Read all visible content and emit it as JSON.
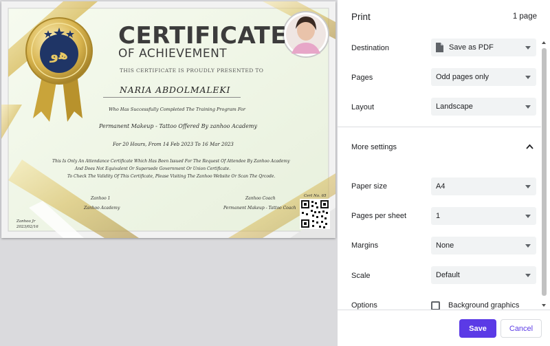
{
  "colors": {
    "accent": "#5b3ae6",
    "gold": "#d6b64e",
    "gold_dark": "#a8862a",
    "panel_bg": "#ffffff",
    "select_bg": "#f1f3f4",
    "preview_bg": "#dadadd"
  },
  "panel": {
    "title": "Print",
    "page_count": "1 page",
    "settings": [
      {
        "label": "Destination",
        "value": "Save as PDF",
        "icon": "document-icon"
      },
      {
        "label": "Pages",
        "value": "Odd pages only"
      },
      {
        "label": "Layout",
        "value": "Landscape"
      }
    ],
    "more_settings": {
      "label": "More settings",
      "icon": "chevron-up-icon"
    },
    "advanced": [
      {
        "label": "Paper size",
        "value": "A4"
      },
      {
        "label": "Pages per sheet",
        "value": "1"
      },
      {
        "label": "Margins",
        "value": "None"
      },
      {
        "label": "Scale",
        "value": "Default"
      }
    ],
    "options": {
      "label": "Options",
      "checkbox_label": "Background graphics",
      "checked": false
    },
    "buttons": {
      "save": "Save",
      "cancel": "Cancel"
    }
  },
  "certificate": {
    "title": "CERTIFICATE",
    "subtitle": "OF ACHIEVEMENT",
    "presented": "THIS CERTIFICATE IS PROUDLY PRESENTED TO",
    "recipient": "NARIA ABDOLMALEKI",
    "line1": "Who Has Successfully Completed The Training Program For",
    "line2": "Permanent Makeup - Tattoo  Offered By  zanhoo Academy",
    "line3": "For 20 Hours, From 14 Feb 2023 To 16 Mar 2023",
    "disclaimer": [
      "This Is Only An Attendance Certificate Which Has Been Issued For The Request Of Attendee By Zanhoo Academy",
      "And Does Not Equivalent Or Supersede Government Or Union Certificate.",
      "To Check The Validity Of This Certificate, Please Visiting The Zanhoo Website Or Scan The Qrcode."
    ],
    "signer_left_title": "Zanhoo 1",
    "signer_left_org": "Zanhoo Academy",
    "signer_right_title": "Zanhoo Coach",
    "signer_right_org": "Permanent Makeup - Tattoo Coach",
    "cert_no": "Cert No. 65",
    "issuer": "Zanhoo Jr",
    "date": "2023/02/16"
  }
}
